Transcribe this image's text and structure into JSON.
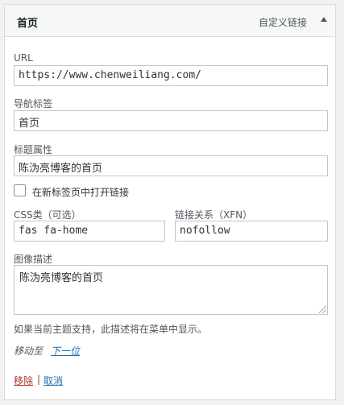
{
  "menu_item": {
    "title": "首页",
    "type_label": "自定义链接"
  },
  "fields": {
    "url": {
      "label": "URL",
      "value": "https://www.chenweiliang.com/"
    },
    "nav_label": {
      "label": "导航标签",
      "value": "首页"
    },
    "title_attr": {
      "label": "标题属性",
      "value": "陈沩亮博客的首页"
    },
    "new_tab": {
      "label": "在新标签页中打开链接",
      "checked": false
    },
    "css_classes": {
      "label": "CSS类（可选）",
      "value": "fas fa-home"
    },
    "xfn": {
      "label": "链接关系（XFN）",
      "value": "nofollow"
    },
    "description": {
      "label": "图像描述",
      "value": "陈沩亮博客的首页",
      "help": "如果当前主题支持，此描述将在菜单中显示。"
    }
  },
  "move": {
    "label": "移动至",
    "next_link": "下一位"
  },
  "actions": {
    "remove": "移除",
    "separator": "|",
    "cancel": "取消"
  }
}
